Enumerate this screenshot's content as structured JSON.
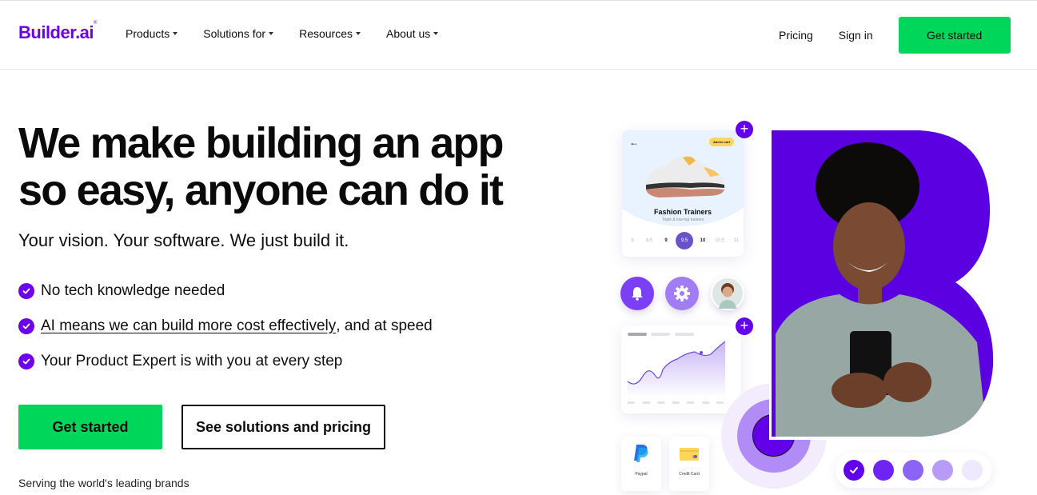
{
  "header": {
    "logo_text": "Builder.ai",
    "nav": [
      {
        "label": "Products"
      },
      {
        "label": "Solutions for"
      },
      {
        "label": "Resources"
      },
      {
        "label": "About us"
      }
    ],
    "pricing_label": "Pricing",
    "signin_label": "Sign in",
    "get_started_label": "Get started"
  },
  "hero": {
    "title_line1": "We make building an app",
    "title_line2": "so easy, anyone can do it",
    "subtitle": "Your vision. Your software. We just build it.",
    "bullets": [
      {
        "text": "No tech knowledge needed"
      },
      {
        "link_text": "AI means we can build more cost effectively",
        "text": ", and at speed"
      },
      {
        "text": "Your Product Expert is with you at every step"
      }
    ],
    "cta_primary": "Get started",
    "cta_secondary": "See solutions and pricing",
    "serving": "Serving the world's leading brands"
  },
  "illustration": {
    "shoe_card": {
      "add_to_cart": "Add to cart",
      "title": "Fashion Trainers",
      "subtitle": "Triple & low-top trainers",
      "sizes": [
        "8",
        "8.5",
        "9",
        "9.5",
        "10",
        "10.5",
        "11"
      ],
      "selected_size": "9.5"
    },
    "payments": [
      {
        "label": "Paypal"
      },
      {
        "label": "Credit Card"
      }
    ],
    "colors": {
      "brand": "#6200ea",
      "green": "#00d659",
      "swatches": [
        "#6200ea",
        "#7a3cf6",
        "#8c63f7",
        "#b79bf6",
        "#efe9fd"
      ]
    }
  }
}
